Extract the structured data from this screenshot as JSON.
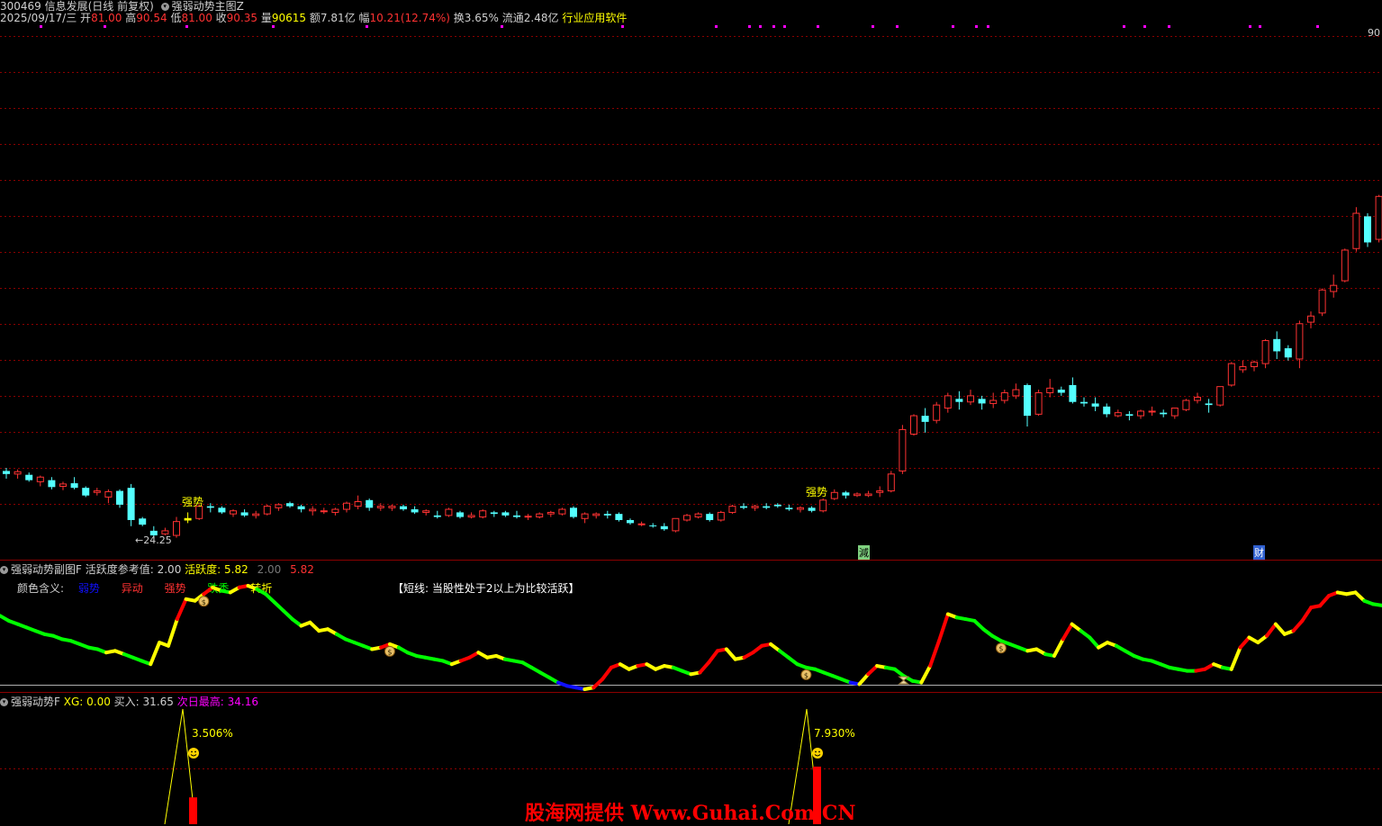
{
  "header": {
    "code_name": "300469 信息发展(日线 前复权)",
    "indicator_name": "强弱动势主图Z",
    "date": "2025/09/17/三",
    "open_label": "开",
    "open": "81.00",
    "high_label": "高",
    "high": "90.54",
    "low_label": "低",
    "low": "81.00",
    "close_label": "收",
    "close": "90.35",
    "vol_label": "量",
    "vol": "90615",
    "amt_label": "额",
    "amt": "7.81亿",
    "chg_label": "幅",
    "chg": "10.21(12.74%)",
    "turnover": "换3.65%",
    "float": "流通2.48亿",
    "industry": "行业应用软件",
    "price_tag": "90"
  },
  "main_chart": {
    "low_marker": "←24.25",
    "strong_label": "强势",
    "reduce_label": "減",
    "finance_label": "财"
  },
  "sub1": {
    "title": "强弱动势副图F",
    "ref_label": "活跃度参考值:",
    "ref_value": "2.00",
    "act_label": "活跃度:",
    "act_value": "5.82",
    "ref2": "2.00",
    "act2": "5.82",
    "legend_title": "颜色含义:",
    "legend": [
      "弱势",
      "异动",
      "强势",
      "跌秃",
      "转折"
    ],
    "note": "【短线: 当股性处于2以上为比较活跃】"
  },
  "sub2": {
    "title": "强弱动势F",
    "xg_label": "XG:",
    "xg_value": "0.00",
    "buy_label": "买入:",
    "buy_value": "31.65",
    "next_high_label": "次日最高:",
    "next_high_value": "34.16",
    "pct1": "3.506%",
    "pct2": "7.930%"
  },
  "watermark": "股海网提供 Www.Guhai.Com.CN",
  "colors": {
    "up": "#ff3232",
    "down": "#54ffff",
    "strong_bar": "#ffff00",
    "weak": "#1010ff",
    "abnormal": "#ffff00",
    "strong": "#ff0000",
    "fall": "#00ff00",
    "grid": "#8b0000",
    "magenta": "#ff00ff",
    "yellow": "#ffff00"
  },
  "chart_data": [
    {
      "type": "candlestick",
      "title": "强弱动势主图Z",
      "ohlc": [
        [
          33.0,
          33.4,
          32.0,
          32.6
        ],
        [
          32.6,
          33.2,
          32.0,
          32.9
        ],
        [
          32.5,
          32.8,
          31.6,
          31.8
        ],
        [
          31.6,
          32.4,
          31.0,
          32.2
        ],
        [
          31.8,
          32.2,
          30.6,
          30.9
        ],
        [
          31.0,
          31.6,
          30.5,
          31.3
        ],
        [
          31.4,
          32.2,
          30.6,
          30.8
        ],
        [
          30.8,
          31.0,
          29.6,
          29.8
        ],
        [
          30.2,
          30.8,
          29.8,
          30.4
        ],
        [
          29.6,
          30.6,
          28.8,
          30.3
        ],
        [
          30.4,
          30.6,
          28.2,
          28.6
        ],
        [
          30.8,
          31.3,
          25.8,
          26.6
        ],
        [
          26.8,
          27.0,
          25.8,
          26.0
        ],
        [
          25.2,
          25.8,
          24.25,
          24.6
        ],
        [
          24.8,
          25.6,
          24.6,
          25.2
        ],
        [
          24.6,
          27.0,
          24.3,
          26.4
        ],
        [
          26.6,
          27.6,
          26.2,
          26.8
        ],
        [
          26.8,
          28.6,
          26.6,
          28.4
        ],
        [
          28.4,
          28.8,
          27.6,
          28.2
        ],
        [
          28.2,
          28.4,
          27.4,
          27.6
        ],
        [
          27.4,
          28.0,
          27.0,
          27.8
        ],
        [
          27.6,
          28.0,
          27.0,
          27.2
        ],
        [
          27.2,
          27.8,
          26.8,
          27.4
        ],
        [
          27.4,
          28.6,
          27.2,
          28.4
        ],
        [
          28.2,
          28.8,
          27.8,
          28.6
        ],
        [
          28.8,
          29.0,
          28.2,
          28.4
        ],
        [
          28.4,
          28.6,
          27.6,
          28.0
        ],
        [
          27.8,
          28.4,
          27.2,
          28.0
        ],
        [
          27.8,
          28.2,
          27.4,
          27.8
        ],
        [
          27.6,
          28.2,
          27.2,
          28.0
        ],
        [
          28.0,
          29.0,
          27.6,
          28.8
        ],
        [
          28.4,
          29.8,
          28.0,
          29.0
        ],
        [
          29.2,
          29.4,
          27.8,
          28.2
        ],
        [
          28.2,
          28.8,
          27.8,
          28.4
        ],
        [
          28.2,
          28.6,
          27.8,
          28.4
        ],
        [
          28.4,
          28.6,
          27.8,
          28.0
        ],
        [
          28.0,
          28.4,
          27.4,
          27.6
        ],
        [
          27.6,
          28.0,
          27.2,
          27.8
        ],
        [
          27.2,
          27.8,
          26.8,
          27.0
        ],
        [
          27.2,
          28.2,
          27.0,
          28.0
        ],
        [
          27.6,
          27.8,
          26.8,
          27.0
        ],
        [
          27.0,
          27.6,
          26.8,
          27.2
        ],
        [
          27.0,
          28.0,
          26.8,
          27.8
        ],
        [
          27.6,
          27.8,
          27.0,
          27.4
        ],
        [
          27.6,
          27.8,
          27.0,
          27.2
        ],
        [
          27.2,
          27.8,
          26.8,
          27.0
        ],
        [
          27.0,
          27.4,
          26.6,
          27.1
        ],
        [
          27.0,
          27.6,
          26.8,
          27.4
        ],
        [
          27.4,
          27.8,
          27.0,
          27.6
        ],
        [
          27.4,
          28.2,
          27.2,
          28.0
        ],
        [
          28.2,
          28.4,
          26.8,
          27.0
        ],
        [
          26.8,
          27.6,
          26.2,
          27.4
        ],
        [
          27.2,
          27.6,
          26.8,
          27.4
        ],
        [
          27.4,
          27.8,
          26.8,
          27.2
        ],
        [
          27.4,
          27.6,
          26.4,
          26.6
        ],
        [
          26.6,
          26.8,
          26.0,
          26.2
        ],
        [
          26.0,
          26.4,
          25.8,
          26.1
        ],
        [
          25.9,
          26.2,
          25.6,
          25.8
        ],
        [
          25.8,
          26.2,
          25.2,
          25.4
        ],
        [
          25.2,
          26.8,
          25.0,
          26.8
        ],
        [
          26.6,
          27.4,
          26.4,
          27.2
        ],
        [
          27.0,
          27.6,
          26.8,
          27.4
        ],
        [
          27.4,
          27.6,
          26.4,
          26.6
        ],
        [
          26.6,
          27.8,
          26.4,
          27.6
        ],
        [
          27.6,
          28.6,
          27.4,
          28.4
        ],
        [
          28.4,
          28.8,
          28.0,
          28.2
        ],
        [
          28.2,
          28.6,
          27.8,
          28.4
        ],
        [
          28.4,
          28.8,
          28.0,
          28.2
        ],
        [
          28.6,
          28.8,
          28.2,
          28.4
        ],
        [
          28.2,
          28.6,
          27.8,
          28.0
        ],
        [
          28.0,
          28.4,
          27.6,
          28.2
        ],
        [
          28.2,
          28.4,
          27.6,
          27.8
        ],
        [
          27.8,
          29.4,
          27.6,
          29.2
        ],
        [
          29.4,
          30.6,
          29.2,
          30.2
        ],
        [
          30.2,
          30.4,
          29.4,
          29.8
        ],
        [
          29.8,
          30.2,
          29.6,
          30.0
        ],
        [
          29.8,
          30.4,
          29.6,
          30.0
        ],
        [
          30.2,
          31.0,
          29.6,
          30.4
        ],
        [
          30.4,
          33.0,
          30.2,
          32.6
        ],
        [
          33.0,
          39.0,
          32.6,
          38.4
        ],
        [
          37.8,
          40.4,
          37.6,
          40.2
        ],
        [
          40.2,
          41.2,
          38.0,
          39.4
        ],
        [
          39.6,
          42.0,
          39.2,
          41.6
        ],
        [
          41.2,
          43.2,
          40.6,
          42.8
        ],
        [
          42.4,
          43.4,
          41.0,
          42.0
        ],
        [
          42.0,
          43.6,
          41.6,
          42.8
        ],
        [
          42.4,
          42.8,
          41.0,
          41.8
        ],
        [
          41.8,
          43.2,
          41.2,
          42.2
        ],
        [
          42.2,
          43.6,
          41.8,
          43.2
        ],
        [
          42.8,
          44.4,
          42.4,
          43.6
        ],
        [
          44.2,
          44.4,
          38.8,
          40.2
        ],
        [
          40.4,
          43.6,
          40.2,
          43.2
        ],
        [
          43.2,
          45.0,
          42.6,
          43.8
        ],
        [
          43.6,
          44.0,
          42.8,
          43.2
        ],
        [
          44.2,
          45.2,
          41.8,
          42.0
        ],
        [
          42.0,
          42.6,
          41.4,
          41.8
        ],
        [
          41.8,
          42.6,
          40.8,
          41.4
        ],
        [
          41.4,
          41.8,
          40.0,
          40.4
        ],
        [
          40.2,
          41.0,
          40.0,
          40.6
        ],
        [
          40.4,
          40.8,
          39.6,
          40.2
        ],
        [
          40.2,
          41.0,
          39.8,
          40.8
        ],
        [
          40.8,
          41.4,
          40.2,
          40.8
        ],
        [
          40.6,
          41.0,
          40.0,
          40.4
        ],
        [
          40.2,
          41.2,
          39.8,
          41.2
        ],
        [
          41.0,
          42.4,
          40.8,
          42.2
        ],
        [
          42.2,
          43.2,
          41.8,
          42.6
        ],
        [
          41.8,
          42.4,
          40.6,
          41.6
        ],
        [
          41.6,
          44.0,
          41.4,
          44.0
        ],
        [
          44.2,
          47.2,
          44.0,
          47.0
        ],
        [
          46.2,
          47.4,
          45.8,
          46.6
        ],
        [
          46.6,
          47.4,
          46.0,
          47.2
        ],
        [
          47.0,
          50.2,
          46.4,
          50.0
        ],
        [
          50.2,
          51.2,
          47.6,
          48.6
        ],
        [
          49.0,
          49.4,
          47.4,
          47.8
        ],
        [
          47.6,
          52.6,
          46.4,
          52.2
        ],
        [
          52.4,
          53.8,
          51.6,
          53.2
        ],
        [
          53.6,
          56.8,
          53.2,
          56.6
        ],
        [
          56.4,
          58.6,
          55.6,
          57.2
        ],
        [
          57.8,
          62.0,
          57.6,
          61.8
        ],
        [
          62.0,
          67.4,
          61.6,
          66.6
        ],
        [
          66.2,
          66.6,
          62.2,
          62.8
        ],
        [
          63.2,
          69.0,
          62.8,
          68.8
        ],
        [
          68.8,
          74.0,
          68.0,
          73.0
        ],
        [
          75.0,
          77.0,
          71.2,
          73.6
        ],
        [
          73.6,
          74.4,
          66.8,
          71.4
        ],
        [
          72.0,
          76.0,
          68.0,
          73.8
        ],
        [
          74.0,
          78.6,
          70.0,
          72.0
        ],
        [
          81.0,
          90.54,
          81.0,
          90.35
        ]
      ]
    },
    {
      "type": "line",
      "title": "强弱动势副图F",
      "ylabel": "活跃度",
      "series": [
        {
          "name": "活跃度",
          "values": [
            5.2,
            4.9,
            4.7,
            4.5,
            4.3,
            4.1,
            4.0,
            3.8,
            3.7,
            3.5,
            3.3,
            3.2,
            3.0,
            3.1,
            2.9,
            2.7,
            2.5,
            2.3,
            3.6,
            3.4,
            5.0,
            6.2,
            6.1,
            6.5,
            6.9,
            6.7,
            6.6,
            6.9,
            7.0,
            6.8,
            6.5,
            6.0,
            5.5,
            5.0,
            4.6,
            4.8,
            4.3,
            4.4,
            4.1,
            3.8,
            3.6,
            3.4,
            3.2,
            3.3,
            3.5,
            3.3,
            3.0,
            2.8,
            2.7,
            2.6,
            2.5,
            2.3,
            2.5,
            2.7,
            3.0,
            2.7,
            2.8,
            2.6,
            2.5,
            2.4,
            2.1,
            1.8,
            1.5,
            1.2,
            1.0,
            0.9,
            0.8,
            0.9,
            1.4,
            2.1,
            2.3,
            2.0,
            2.2,
            2.3,
            2.0,
            2.2,
            2.1,
            1.9,
            1.7,
            1.8,
            2.4,
            3.1,
            3.2,
            2.6,
            2.7,
            3.0,
            3.4,
            3.5,
            3.1,
            2.7,
            2.3,
            2.1,
            2.0,
            1.8,
            1.6,
            1.4,
            1.2,
            1.1,
            1.7,
            2.2,
            2.1,
            2.0,
            1.6,
            1.3,
            1.2,
            2.2,
            3.7,
            5.3,
            5.1,
            5.0,
            4.9,
            4.4,
            4.0,
            3.7,
            3.5,
            3.3,
            3.1,
            3.2,
            2.9,
            2.8,
            3.8,
            4.7,
            4.3,
            3.9,
            3.3,
            3.6,
            3.4,
            3.1,
            2.8,
            2.6,
            2.5,
            2.3,
            2.1,
            2.0,
            1.9,
            1.9,
            2.0,
            2.3,
            2.1,
            2.0,
            3.3,
            3.9,
            3.6,
            4.0,
            4.7,
            4.1,
            4.3,
            4.9,
            5.7,
            5.8,
            6.4,
            6.6,
            6.5,
            6.6,
            6.1,
            5.9,
            5.82
          ]
        }
      ],
      "reference": 2.0,
      "markers": [
        {
          "type": "money-bag",
          "indices": [
            23,
            44,
            91,
            113
          ]
        },
        {
          "type": "hourglass",
          "indices": [
            102
          ]
        }
      ]
    },
    {
      "type": "bar",
      "title": "强弱动势F",
      "signals": [
        {
          "label": "3.506%",
          "value": 3.506
        },
        {
          "label": "7.930%",
          "value": 7.93
        }
      ],
      "xg": 0.0,
      "buy": 31.65,
      "next_high": 34.16
    }
  ]
}
